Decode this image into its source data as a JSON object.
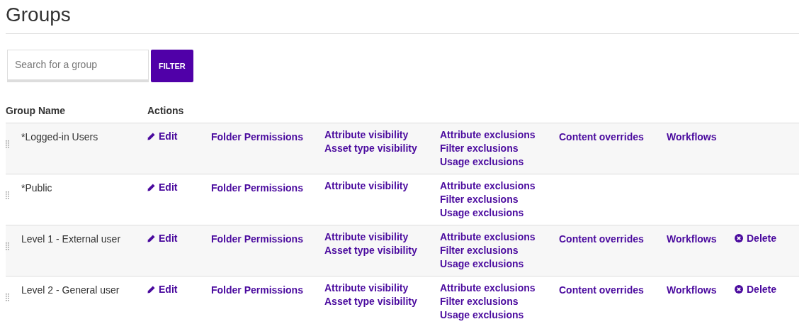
{
  "title": "Groups",
  "search": {
    "placeholder": "Search for a group"
  },
  "filter_button": "FILTER",
  "table": {
    "columns": [
      "Group Name",
      "Actions"
    ],
    "rows": [
      {
        "name": "*Logged-in Users",
        "edit": "Edit",
        "folder_permissions": "Folder Permissions",
        "visibility": [
          "Attribute visibility",
          "Asset type visibility"
        ],
        "exclusions": [
          "Attribute exclusions",
          "Filter exclusions",
          "Usage exclusions"
        ],
        "content_overrides": "Content overrides",
        "workflows": "Workflows"
      },
      {
        "name": "*Public",
        "edit": "Edit",
        "folder_permissions": "Folder Permissions",
        "visibility": [
          "Attribute visibility"
        ],
        "exclusions": [
          "Attribute exclusions",
          "Filter exclusions",
          "Usage exclusions"
        ]
      },
      {
        "name": "Level 1 - External user",
        "edit": "Edit",
        "folder_permissions": "Folder Permissions",
        "visibility": [
          "Attribute visibility",
          "Asset type visibility"
        ],
        "exclusions": [
          "Attribute exclusions",
          "Filter exclusions",
          "Usage exclusions"
        ],
        "content_overrides": "Content overrides",
        "workflows": "Workflows",
        "delete": "Delete"
      },
      {
        "name": "Level 2 - General user",
        "edit": "Edit",
        "folder_permissions": "Folder Permissions",
        "visibility": [
          "Attribute visibility",
          "Asset type visibility"
        ],
        "exclusions": [
          "Attribute exclusions",
          "Filter exclusions",
          "Usage exclusions"
        ],
        "content_overrides": "Content overrides",
        "workflows": "Workflows",
        "delete": "Delete"
      }
    ]
  }
}
